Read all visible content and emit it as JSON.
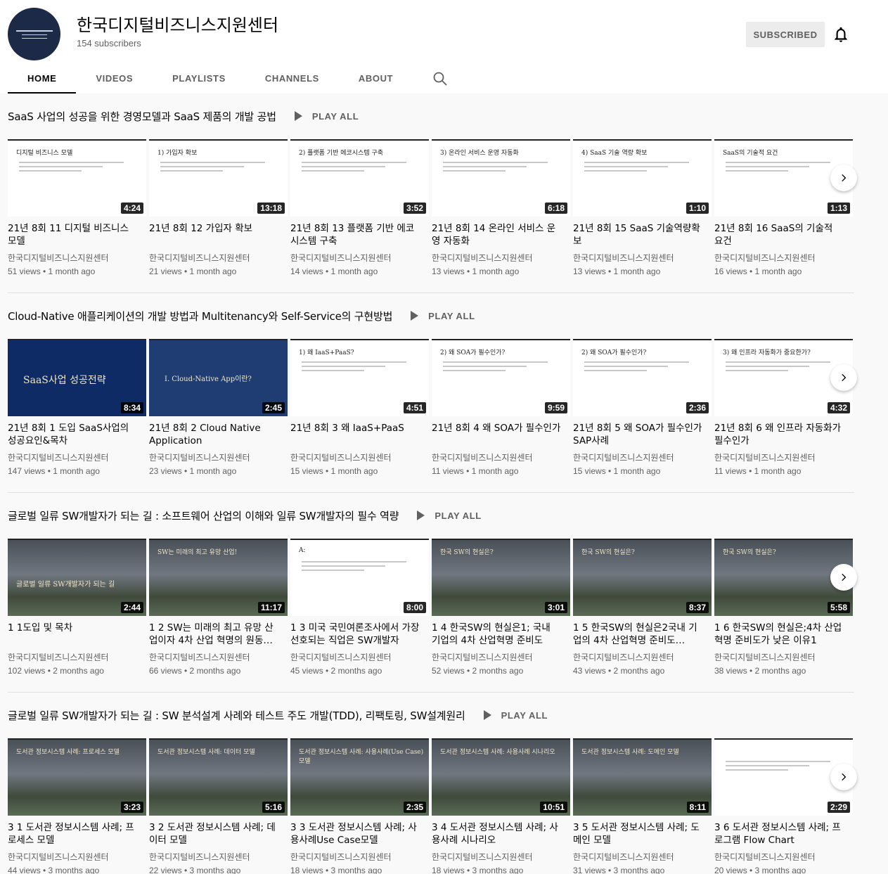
{
  "channel": {
    "name": "한국디지털비즈니스지원센터",
    "subscribers": "154 subscribers",
    "subscribe_label": "SUBSCRIBED"
  },
  "tabs": [
    "HOME",
    "VIDEOS",
    "PLAYLISTS",
    "CHANNELS",
    "ABOUT"
  ],
  "icons": {
    "bell": "bell-icon",
    "search": "search-icon",
    "play": "play-icon",
    "next": "chevron-right-icon"
  },
  "colors": {
    "meta": "#606060",
    "text": "#030303",
    "bg": "#f9f9f9",
    "subscribe_bg": "#ececec"
  },
  "play_all_label": "PLAY ALL",
  "sections": [
    {
      "title": "SaaS 사업의 성공을 위한 경영모델과 SaaS 제품의 개발 공법",
      "videos": [
        {
          "title": "21년 8회 11 디지털 비즈니스 모델",
          "channel": "한국디지털비즈니스지원센터",
          "meta": "51 views • 1 month ago",
          "duration": "4:24",
          "slide": "디지털 비즈니스 모델"
        },
        {
          "title": "21년 8회 12 가입자 확보",
          "channel": "한국디지털비즈니스지원센터",
          "meta": "21 views • 1 month ago",
          "duration": "13:18",
          "slide": "1) 가입자 확보"
        },
        {
          "title": "21년 8회 13 플랫폼 기반 에코시스템 구축",
          "channel": "한국디지털비즈니스지원센터",
          "meta": "14 views • 1 month ago",
          "duration": "3:52",
          "slide": "2) 플랫폼 기반 에코시스템 구축"
        },
        {
          "title": "21년 8회 14 온라인 서비스 운영 자동화",
          "channel": "한국디지털비즈니스지원센터",
          "meta": "13 views • 1 month ago",
          "duration": "6:18",
          "slide": "3) 온라인 서비스 운영 자동화"
        },
        {
          "title": "21년 8회 15 SaaS 기술역량확보",
          "channel": "한국디지털비즈니스지원센터",
          "meta": "13 views • 1 month ago",
          "duration": "1:10",
          "slide": "4) SaaS 기술 역량 확보"
        },
        {
          "title": "21년 8회 16 SaaS의 기술적 요건",
          "channel": "한국디지털비즈니스지원센터",
          "meta": "16 views • 1 month ago",
          "duration": "1:13",
          "slide": "SaaS의 기술적 요건"
        }
      ]
    },
    {
      "title": "Cloud-Native 애플리케이션의 개발 방법과 Multitenancy와 Self-Service의 구현방법",
      "videos": [
        {
          "title": "21년 8회 1 도입 SaaS사업의 성공요인&목차",
          "channel": "한국디지털비즈니스지원센터",
          "meta": "147 views • 1 month ago",
          "duration": "8:34",
          "slide": "SaaS사업 성공전략"
        },
        {
          "title": "21년 8회 2 Cloud Native Application",
          "channel": "한국디지털비즈니스지원센터",
          "meta": "23 views • 1 month ago",
          "duration": "2:45",
          "slide": "I. Cloud-Native App이란?"
        },
        {
          "title": "21년 8회 3 왜 IaaS+PaaS",
          "channel": "한국디지털비즈니스지원센터",
          "meta": "15 views • 1 month ago",
          "duration": "4:51",
          "slide": "1) 왜 IaaS+PaaS?"
        },
        {
          "title": "21년 8회 4 왜 SOA가 필수인가",
          "channel": "한국디지털비즈니스지원센터",
          "meta": "11 views • 1 month ago",
          "duration": "9:59",
          "slide": "2) 왜 SOA가 필수인가?"
        },
        {
          "title": "21년 8회 5 왜 SOA가 필수인가 SAP사례",
          "channel": "한국디지털비즈니스지원센터",
          "meta": "15 views • 1 month ago",
          "duration": "2:36",
          "slide": "2) 왜 SOA가 필수인가?"
        },
        {
          "title": "21년 8회 6 왜 인프라 자동화가 필수인가",
          "channel": "한국디지털비즈니스지원센터",
          "meta": "11 views • 1 month ago",
          "duration": "4:32",
          "slide": "3) 왜 인프라 자동화가 중요한가?"
        }
      ]
    },
    {
      "title": "글로벌 일류 SW개발자가 되는 길 : 소프트웨어 산업의 이해와 일류 SW개발자의 필수 역량",
      "videos": [
        {
          "title": "1 1도입 및 목차",
          "channel": "한국디지털비즈니스지원센터",
          "meta": "102 views • 2 months ago",
          "duration": "2:44",
          "slide": "글로벌 일류 SW개발자가 되는 길"
        },
        {
          "title": "1 2 SW는 미래의 최고 유망 산업이자 4차 산업 혁명의 원동…",
          "channel": "한국디지털비즈니스지원센터",
          "meta": "66 views • 2 months ago",
          "duration": "11:17",
          "slide": "SW는 미래의 최고 유망 산업!"
        },
        {
          "title": "1 3 미국 국민여론조사에서 가장 선호되는 직업은 SW개발자",
          "channel": "한국디지털비즈니스지원센터",
          "meta": "45 views • 2 months ago",
          "duration": "8:00",
          "slide": "A:"
        },
        {
          "title": "1 4 한국SW의 현실은1; 국내 기업의 4차 산업혁명 준비도",
          "channel": "한국디지털비즈니스지원센터",
          "meta": "52 views • 2 months ago",
          "duration": "3:01",
          "slide": "한국 SW의 현실은?"
        },
        {
          "title": "1 5 한국SW의 현실은2국내 기업의 4차 산업혁명 준비도…",
          "channel": "한국디지털비즈니스지원센터",
          "meta": "43 views • 2 months ago",
          "duration": "8:37",
          "slide": "한국 SW의 현실은?"
        },
        {
          "title": "1 6 한국SW의 현실은;4차 산업혁명 준비도가 낮은 이유1",
          "channel": "한국디지털비즈니스지원센터",
          "meta": "38 views • 2 months ago",
          "duration": "5:58",
          "slide": "한국 SW의 현실은?"
        }
      ]
    },
    {
      "title": "글로벌 일류 SW개발자가 되는 길 : SW 분석설계 사례와 테스트 주도 개발(TDD), 리팩토링, SW설계원리",
      "videos": [
        {
          "title": "3 1 도서관 정보시스템 사례; 프로세스 모델",
          "channel": "한국디지털비즈니스지원센터",
          "meta": "44 views • 3 months ago",
          "duration": "3:23",
          "slide": "도서관 정보시스템 사례: 프로세스 모델"
        },
        {
          "title": "3 2 도서관 정보시스템 사례; 데이터 모델",
          "channel": "한국디지털비즈니스지원센터",
          "meta": "22 views • 3 months ago",
          "duration": "5:16",
          "slide": "도서관 정보시스템 사례: 데이터 모델"
        },
        {
          "title": "3 3 도서관 정보시스템 사례; 사용사례Use Case모델",
          "channel": "한국디지털비즈니스지원센터",
          "meta": "18 views • 3 months ago",
          "duration": "2:35",
          "slide": "도서관 정보시스템 사례: 사용사례(Use Case) 모델"
        },
        {
          "title": "3 4 도서관 정보시스템 사례; 사용사례 시나리오",
          "channel": "한국디지털비즈니스지원센터",
          "meta": "18 views • 3 months ago",
          "duration": "10:51",
          "slide": "도서관 정보시스템 사례: 사용사례 시나리오"
        },
        {
          "title": "3 5 도서관 정보시스템 사례; 도메인 모델",
          "channel": "한국디지털비즈니스지원센터",
          "meta": "31 views • 3 months ago",
          "duration": "8:11",
          "slide": "도서관 정보시스템 사례: 도메인 모델"
        },
        {
          "title": "3 6 도서관 정보시스템 사례; 프로그램 Flow Chart",
          "channel": "한국디지털비즈니스지원센터",
          "meta": "20 views • 3 months ago",
          "duration": "2:29",
          "slide": ""
        }
      ]
    }
  ]
}
